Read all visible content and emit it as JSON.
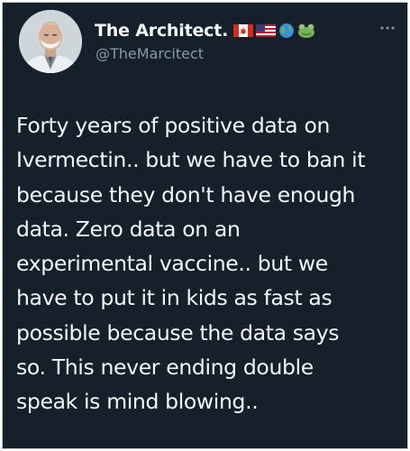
{
  "profile": {
    "display_name": "The Architect.",
    "handle": "@TheMarcitect",
    "avatar_icon": "elderly-man-avatar",
    "name_emojis": [
      "canada-flag-icon",
      "usa-flag-icon",
      "globe-icon",
      "frog-icon"
    ]
  },
  "menu": {
    "more_icon": "more-dots-icon"
  },
  "tweet": {
    "lines": [
      "Forty years of positive data on",
      "Ivermectin.. but we have to ban it",
      "because they don't have enough",
      "data. Zero data on an",
      "experimental vaccine.. but we",
      "have to put it in kids as fast as",
      "possible because the data says",
      "so. This never ending double",
      "speak is mind blowing.."
    ]
  },
  "colors": {
    "background": "#15202b",
    "primary_text": "#f5f8fa",
    "secondary_text": "#8899a6"
  }
}
